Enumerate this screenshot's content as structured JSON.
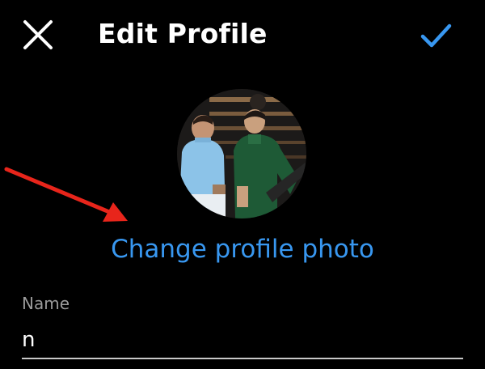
{
  "header": {
    "title": "Edit Profile",
    "close_icon": "close-icon",
    "confirm_icon": "checkmark-icon",
    "accent_color": "#3897f0"
  },
  "profile": {
    "avatar_alt": "profile-photo",
    "change_photo_label": "Change profile photo"
  },
  "annotation": {
    "arrow_color": "#e8251b"
  },
  "form": {
    "name_label": "Name",
    "name_value": "n"
  }
}
